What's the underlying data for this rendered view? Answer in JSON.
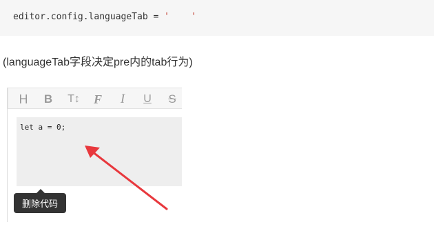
{
  "code_block": {
    "prefix": "editor.config.languageTab = ",
    "string_value": "'    '"
  },
  "caption": "(languageTab字段决定pre内的tab行为)",
  "editor": {
    "toolbar": {
      "buttons": [
        {
          "icon": "heading-icon",
          "glyph": "H"
        },
        {
          "icon": "bold-icon",
          "glyph": "B"
        },
        {
          "icon": "font-size-icon",
          "glyph": "T↕"
        },
        {
          "icon": "font-family-icon",
          "glyph": "F"
        },
        {
          "icon": "italic-icon",
          "glyph": "I"
        },
        {
          "icon": "underline-icon",
          "glyph": "U"
        },
        {
          "icon": "strikethrough-icon",
          "glyph": "S"
        }
      ]
    },
    "pre_content": "let a = 0;",
    "tooltip": "删除代码"
  },
  "colors": {
    "annotation_arrow": "#e8383d",
    "toolbar_icon": "#9a9a9a",
    "tooltip_bg": "#333333"
  }
}
